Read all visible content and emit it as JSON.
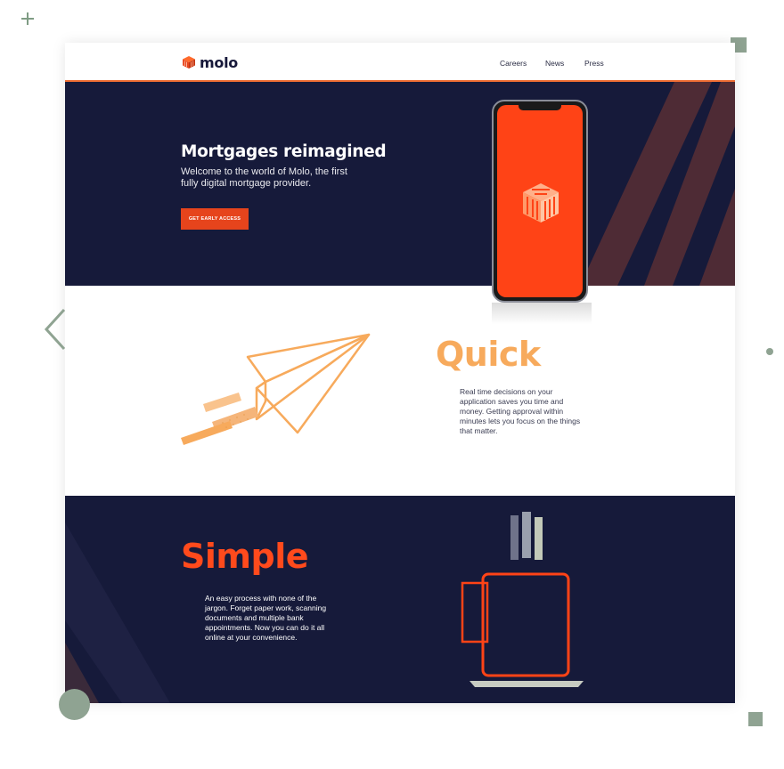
{
  "nav": {
    "brand": "molo",
    "links": [
      "Careers",
      "News",
      "Press"
    ]
  },
  "hero": {
    "title": "Mortgages reimagined",
    "subtitle": "Welcome to the world of Molo, the first fully digital mortgage provider.",
    "cta": "GET EARLY ACCESS"
  },
  "quick": {
    "heading": "Quick",
    "body": "Real time decisions on your application saves you time and money. Getting approval within minutes lets you focus on the things that matter."
  },
  "simple": {
    "heading": "Simple",
    "body": "An easy process with none of the jargon. Forget paper work, scanning documents and multiple bank appointments. Now you can do it all online at your convenience."
  },
  "colors": {
    "navy": "#161a3a",
    "orange": "#ff4316",
    "peach": "#f7aa5c",
    "sage": "#8fa392"
  },
  "icons": [
    "plus-icon",
    "chevron-left-icon",
    "molo-logo-icon",
    "paper-plane-icon",
    "mug-icon"
  ]
}
